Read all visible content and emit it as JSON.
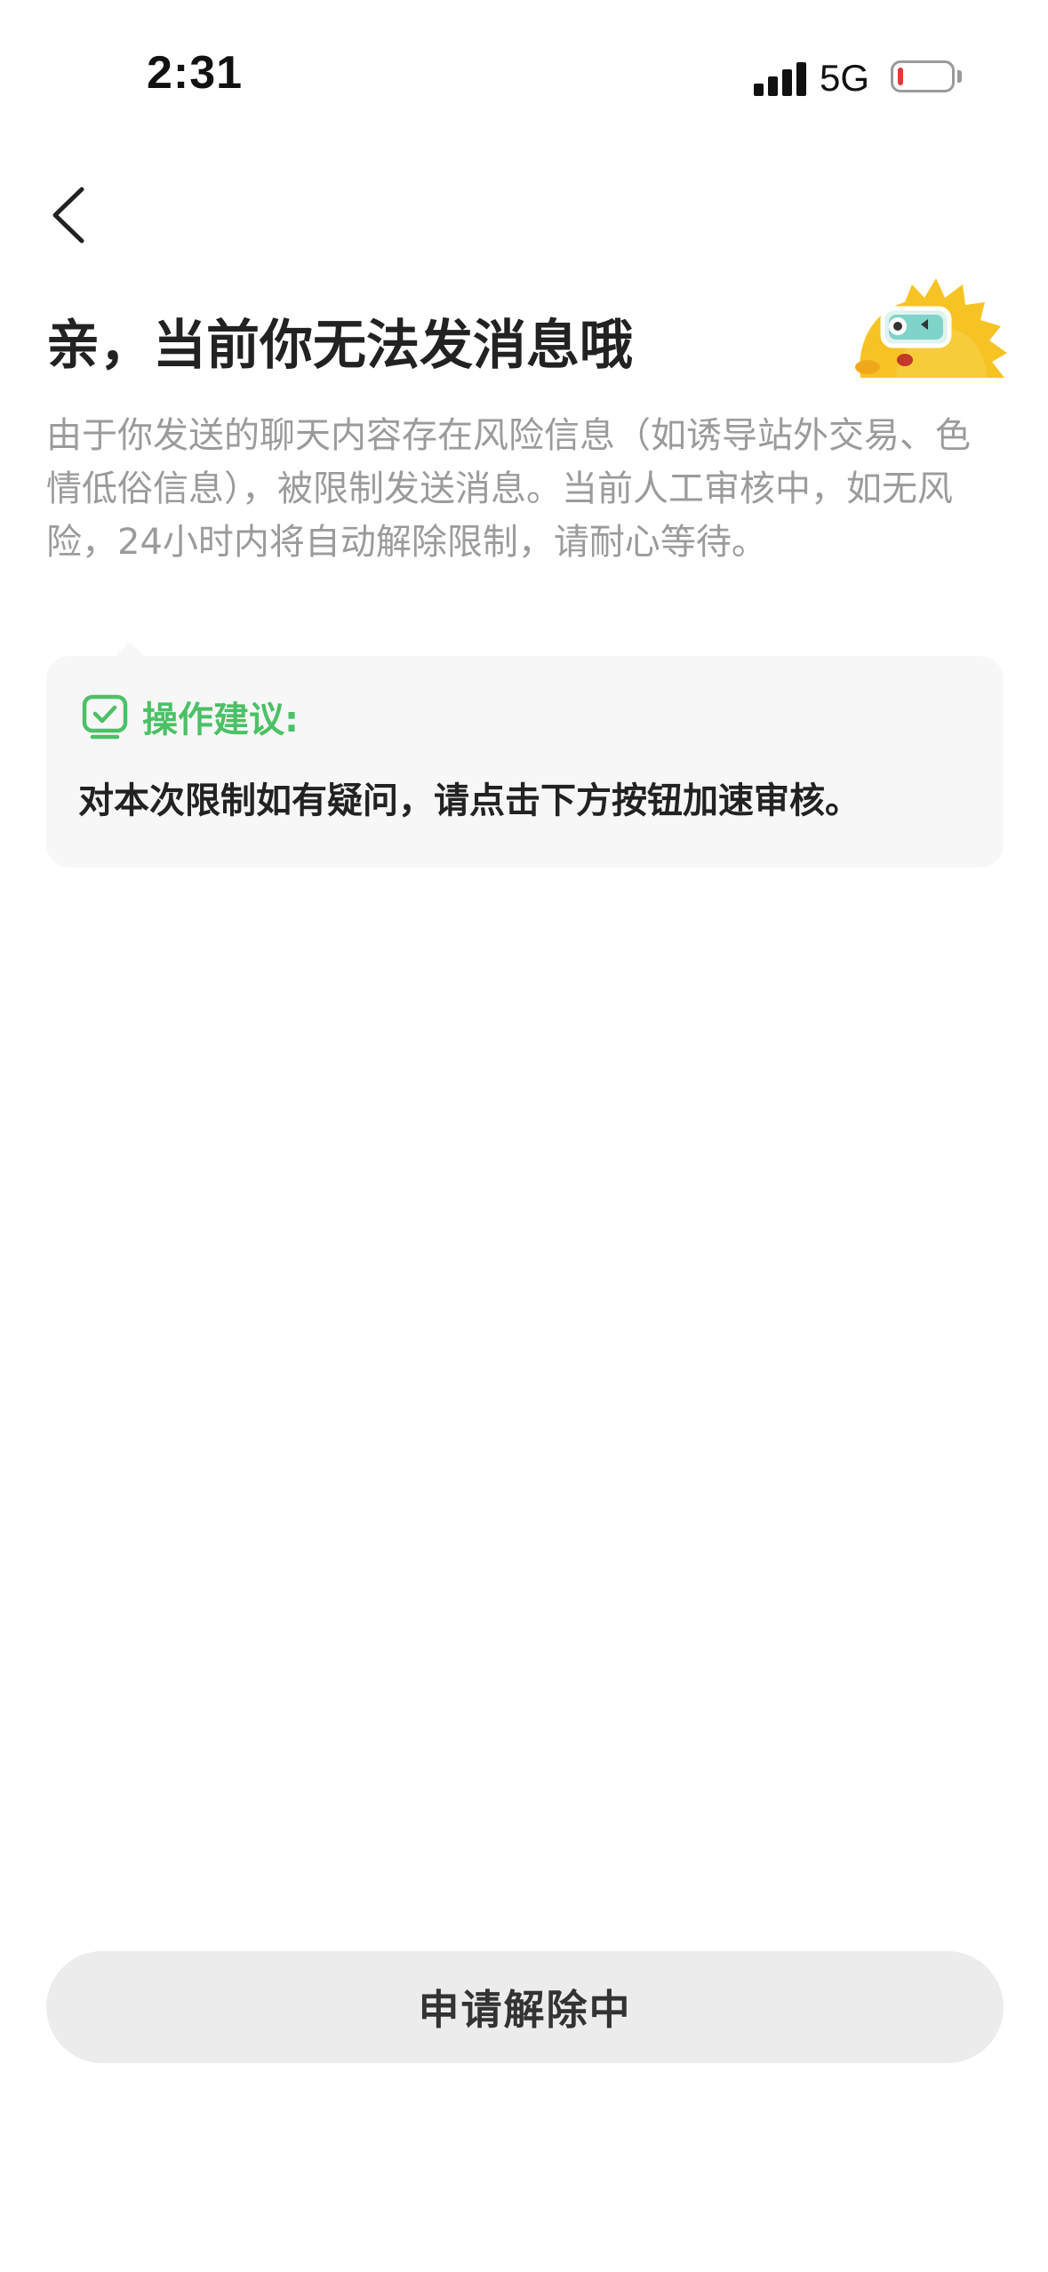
{
  "status_bar": {
    "time": "2:31",
    "network": "5G",
    "signal_bars": 4,
    "battery_low_color": "#e53935"
  },
  "nav": {
    "back_icon": "chevron-left-icon"
  },
  "title": "亲，当前你无法发消息哦",
  "mascot_icon": "yellow-mascot-with-goggles",
  "description": "由于你发送的聊天内容存在风险信息（如诱导站外交易、色情低俗信息），被限制发送消息。当前人工审核中，如无风险，24小时内将自动解除限制，请耐心等待。",
  "suggestion": {
    "icon": "checked-tv-icon",
    "title": "操作建议:",
    "body": "对本次限制如有疑问，请点击下方按钮加速审核。",
    "accent_color": "#4cc066"
  },
  "action_button": {
    "label": "申请解除中",
    "state": "disabled"
  }
}
